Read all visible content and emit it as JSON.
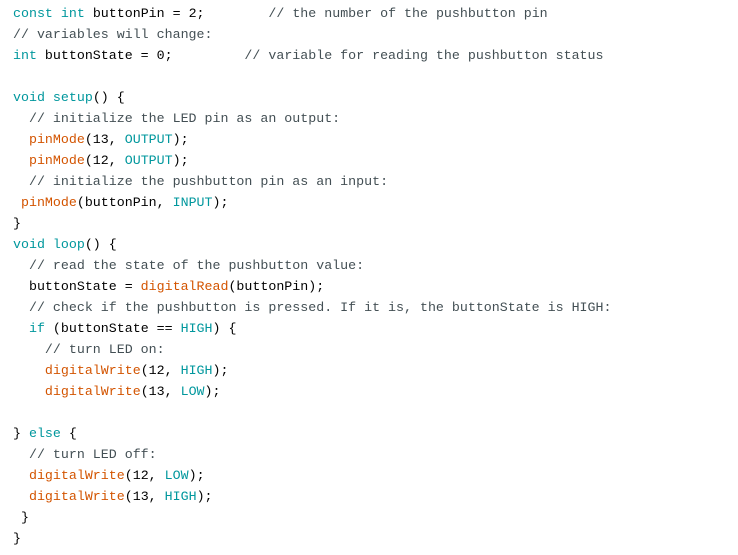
{
  "colors": {
    "background": "#ffffff",
    "keyword": "#00979d",
    "function": "#d35400",
    "constant": "#00979d",
    "comment": "#434f54",
    "plain": "#000000"
  },
  "code": {
    "lines": [
      {
        "tokens": [
          {
            "t": "keyword",
            "v": "const"
          },
          {
            "t": "plain",
            "v": " "
          },
          {
            "t": "keyword",
            "v": "int"
          },
          {
            "t": "plain",
            "v": " buttonPin = 2;        "
          },
          {
            "t": "comment",
            "v": "// the number of the pushbutton pin"
          }
        ]
      },
      {
        "tokens": [
          {
            "t": "comment",
            "v": "// variables will change:"
          }
        ]
      },
      {
        "tokens": [
          {
            "t": "keyword",
            "v": "int"
          },
          {
            "t": "plain",
            "v": " buttonState = 0;         "
          },
          {
            "t": "comment",
            "v": "// variable for reading the pushbutton status"
          }
        ]
      },
      {
        "tokens": []
      },
      {
        "tokens": [
          {
            "t": "keyword",
            "v": "void"
          },
          {
            "t": "plain",
            "v": " "
          },
          {
            "t": "keyword",
            "v": "setup"
          },
          {
            "t": "plain",
            "v": "() {"
          }
        ]
      },
      {
        "tokens": [
          {
            "t": "plain",
            "v": "  "
          },
          {
            "t": "comment",
            "v": "// initialize the LED pin as an output:"
          }
        ]
      },
      {
        "tokens": [
          {
            "t": "plain",
            "v": "  "
          },
          {
            "t": "func",
            "v": "pinMode"
          },
          {
            "t": "plain",
            "v": "(13, "
          },
          {
            "t": "const",
            "v": "OUTPUT"
          },
          {
            "t": "plain",
            "v": ");"
          }
        ]
      },
      {
        "tokens": [
          {
            "t": "plain",
            "v": "  "
          },
          {
            "t": "func",
            "v": "pinMode"
          },
          {
            "t": "plain",
            "v": "(12, "
          },
          {
            "t": "const",
            "v": "OUTPUT"
          },
          {
            "t": "plain",
            "v": ");"
          }
        ]
      },
      {
        "tokens": [
          {
            "t": "plain",
            "v": "  "
          },
          {
            "t": "comment",
            "v": "// initialize the pushbutton pin as an input:"
          }
        ]
      },
      {
        "tokens": [
          {
            "t": "plain",
            "v": " "
          },
          {
            "t": "func",
            "v": "pinMode"
          },
          {
            "t": "plain",
            "v": "(buttonPin, "
          },
          {
            "t": "const",
            "v": "INPUT"
          },
          {
            "t": "plain",
            "v": ");"
          }
        ]
      },
      {
        "tokens": [
          {
            "t": "plain",
            "v": "}"
          }
        ]
      },
      {
        "tokens": [
          {
            "t": "keyword",
            "v": "void"
          },
          {
            "t": "plain",
            "v": " "
          },
          {
            "t": "keyword",
            "v": "loop"
          },
          {
            "t": "plain",
            "v": "() {"
          }
        ]
      },
      {
        "tokens": [
          {
            "t": "plain",
            "v": "  "
          },
          {
            "t": "comment",
            "v": "// read the state of the pushbutton value:"
          }
        ]
      },
      {
        "tokens": [
          {
            "t": "plain",
            "v": "  buttonState = "
          },
          {
            "t": "func",
            "v": "digitalRead"
          },
          {
            "t": "plain",
            "v": "(buttonPin);"
          }
        ]
      },
      {
        "tokens": [
          {
            "t": "plain",
            "v": "  "
          },
          {
            "t": "comment",
            "v": "// check if the pushbutton is pressed. If it is, the buttonState is HIGH:"
          }
        ]
      },
      {
        "tokens": [
          {
            "t": "plain",
            "v": "  "
          },
          {
            "t": "keyword",
            "v": "if"
          },
          {
            "t": "plain",
            "v": " (buttonState == "
          },
          {
            "t": "const",
            "v": "HIGH"
          },
          {
            "t": "plain",
            "v": ") {"
          }
        ]
      },
      {
        "tokens": [
          {
            "t": "plain",
            "v": "    "
          },
          {
            "t": "comment",
            "v": "// turn LED on:"
          }
        ]
      },
      {
        "tokens": [
          {
            "t": "plain",
            "v": "    "
          },
          {
            "t": "func",
            "v": "digitalWrite"
          },
          {
            "t": "plain",
            "v": "(12, "
          },
          {
            "t": "const",
            "v": "HIGH"
          },
          {
            "t": "plain",
            "v": ");"
          }
        ]
      },
      {
        "tokens": [
          {
            "t": "plain",
            "v": "    "
          },
          {
            "t": "func",
            "v": "digitalWrite"
          },
          {
            "t": "plain",
            "v": "(13, "
          },
          {
            "t": "const",
            "v": "LOW"
          },
          {
            "t": "plain",
            "v": ");"
          }
        ]
      },
      {
        "tokens": []
      },
      {
        "tokens": [
          {
            "t": "plain",
            "v": "} "
          },
          {
            "t": "keyword",
            "v": "else"
          },
          {
            "t": "plain",
            "v": " {"
          }
        ]
      },
      {
        "tokens": [
          {
            "t": "plain",
            "v": "  "
          },
          {
            "t": "comment",
            "v": "// turn LED off:"
          }
        ]
      },
      {
        "tokens": [
          {
            "t": "plain",
            "v": "  "
          },
          {
            "t": "func",
            "v": "digitalWrite"
          },
          {
            "t": "plain",
            "v": "(12, "
          },
          {
            "t": "const",
            "v": "LOW"
          },
          {
            "t": "plain",
            "v": ");"
          }
        ]
      },
      {
        "tokens": [
          {
            "t": "plain",
            "v": "  "
          },
          {
            "t": "func",
            "v": "digitalWrite"
          },
          {
            "t": "plain",
            "v": "(13, "
          },
          {
            "t": "const",
            "v": "HIGH"
          },
          {
            "t": "plain",
            "v": ");"
          }
        ]
      },
      {
        "tokens": [
          {
            "t": "plain",
            "v": " }"
          }
        ]
      },
      {
        "tokens": [
          {
            "t": "plain",
            "v": "}"
          }
        ]
      }
    ]
  }
}
